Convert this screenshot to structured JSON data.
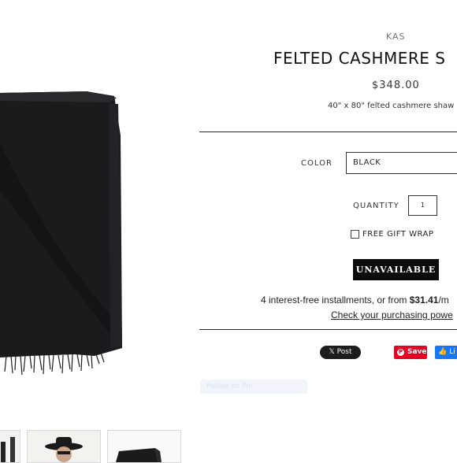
{
  "product": {
    "brand": "KAS",
    "title": "FELTED CASHMERE S",
    "price": "$348.00",
    "description": "40\" x 80\" felted cashmere shaw"
  },
  "options": {
    "color_label": "COLOR",
    "color_value": "BLACK",
    "quantity_label": "QUANTITY",
    "quantity_value": "1",
    "gift_wrap_label": "FREE GIFT WRAP"
  },
  "actions": {
    "unavailable_label": "UNAVAILABLE"
  },
  "financing": {
    "prefix": "4 interest-free installments, or from ",
    "amount": "$31.41",
    "suffix": "/m",
    "link_text": "Check your purchasing powe"
  },
  "social": {
    "tweet_label": "Post",
    "tweet_icon": "x-logo-icon",
    "pin_label": "Save",
    "pin_icon": "pinterest-icon",
    "fb_label": "Li",
    "fb_icon": "facebook-like-icon"
  },
  "ghost_widget": {
    "label": "Follow on Pin"
  },
  "colors": {
    "accent_dark": "#0c0c0c",
    "pinterest": "#e60023",
    "facebook": "#1877f2"
  }
}
